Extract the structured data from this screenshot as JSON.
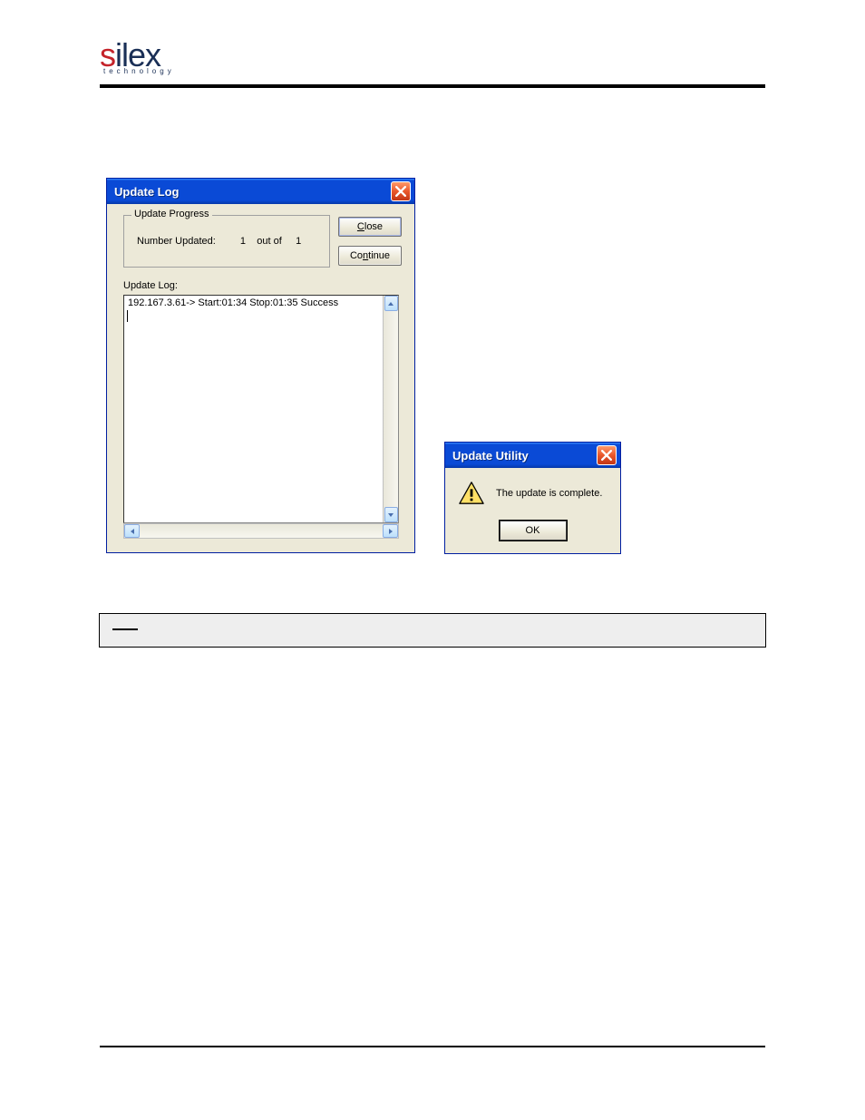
{
  "header": {
    "logo_prefix": "s",
    "logo_rest": "ilex",
    "logo_sub": "technology"
  },
  "update_log_window": {
    "title": "Update Log",
    "group_title": "Update Progress",
    "number_updated_label": "Number Updated:",
    "number_updated_current": "1",
    "number_updated_sep": "out of",
    "number_updated_total": "1",
    "close_label": "Close",
    "continue_label": "Continue",
    "log_label": "Update Log:",
    "log_entries": [
      "192.167.3.61-> Start:01:34 Stop:01:35  Success"
    ]
  },
  "update_utility_window": {
    "title": "Update Utility",
    "message": "The update is complete.",
    "ok_label": "OK"
  }
}
